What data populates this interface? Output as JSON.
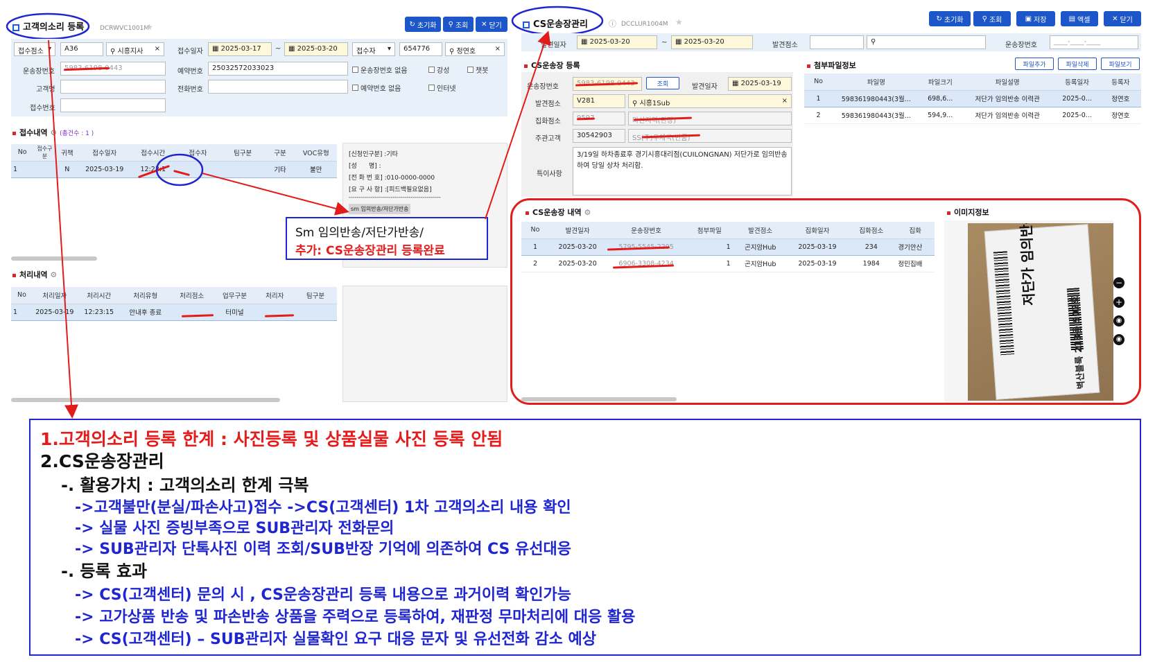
{
  "left": {
    "title": "고객의소리 등록",
    "code": "DCRWVC1001M",
    "buttons": {
      "reset": "초기화",
      "search": "조회",
      "close": "닫기"
    },
    "filters": {
      "recv_point_label": "접수점소",
      "recv_point_code": "A36",
      "recv_point_name": "시흥지사",
      "recv_date_label": "접수일자",
      "date_from": "2025-03-17",
      "date_sep": "~",
      "date_to": "2025-03-20",
      "receiver_label": "접수자",
      "receiver_id": "654776",
      "receiver_name": "정연호",
      "waybill_label": "운송장번호",
      "waybill_value": "5983-6198-0443",
      "reserve_label": "예약번호",
      "reserve_value": "25032572033023",
      "chk_no_waybill": "운송장번호 없음",
      "chk_strong": "강성",
      "chk_chatbot": "챗봇",
      "customer_label": "고객명",
      "phone_label": "전화번호",
      "chk_no_reserve": "예약번호 없음",
      "chk_internet": "인터넷",
      "recv_no_label": "접수번호"
    },
    "receipt": {
      "title": "접수내역",
      "count": "(총건수 : 1 )",
      "headers": [
        "No",
        "접수구분",
        "귀책",
        "접수일자",
        "접수시간",
        "접수자",
        "팀구분",
        "구분",
        "VOC유형"
      ],
      "rows": [
        [
          "1",
          "",
          "N",
          "2025-03-19",
          "12:23:1",
          "",
          "",
          "기타",
          "불만"
        ]
      ]
    },
    "detail": {
      "l1": "[신청인구분] :기타",
      "l2": "[성      명] :",
      "l3": "[전 화 번 호] :010-0000-0000",
      "l4": "[요 구 사 항] :[피드백필요없음]",
      "dash": "----------------------------------------------",
      "tag": "sm 임의반송/저단가반송"
    },
    "process": {
      "title": "처리내역",
      "headers": [
        "No",
        "처리일자",
        "처리시간",
        "처리유형",
        "처리점소",
        "업무구분",
        "처리자",
        "팀구분"
      ],
      "rows": [
        [
          "1",
          "2025-03-19",
          "12:23:15",
          "안내후 종료",
          "",
          "터미널",
          "",
          ""
        ]
      ]
    }
  },
  "callout": {
    "line1": "Sm 임의반송/저단가반송/",
    "line2": "추가: CS운송장관리 등록완료"
  },
  "right": {
    "title": "CS운송장관리",
    "code": "DCCLUR1004M",
    "buttons": {
      "reset": "초기화",
      "search": "조회",
      "save": "저장",
      "excel": "엑셀",
      "close": "닫기"
    },
    "filters": {
      "issue_date_label": "발견일자",
      "date_from": "2025-03-20",
      "date_sep": "~",
      "date_to": "2025-03-20",
      "issue_point_label": "발견점소",
      "waybill_label": "운송장번호",
      "waybill_placeholder": "____-____-____"
    },
    "register": {
      "title": "CS운송장 등록",
      "waybill_label": "운송장번호",
      "waybill_value": "5983-6198-0443",
      "search_btn": "조회",
      "issue_date_label": "발견일자",
      "issue_date": "2025-03-19",
      "issue_point_label": "발견점소",
      "issue_point_code": "V281",
      "issue_point_name": "시흥1Sub",
      "collect_point_label": "집화점소",
      "collect_point_code": "9597",
      "collect_point_name": "마산지역(관장)",
      "main_customer_label": "주관고객",
      "main_customer_code": "30542903",
      "main_customer_name": "SS(주)우체국(반품)",
      "note_label": "특이사항",
      "note_text": "3/19일 하차종료후 경기시흥대리점(CUILONGNAN) 저단가로 임의반송하여 당일 상차 처리함."
    },
    "attach": {
      "title": "첨부파일정보",
      "btn_add": "파일추가",
      "btn_delete": "파일삭제",
      "btn_view": "파일보기",
      "headers": [
        "No",
        "파일명",
        "파일크기",
        "파일설명",
        "등록일자",
        "등록자"
      ],
      "rows": [
        [
          "1",
          "598361980443(3월...",
          "698,6...",
          "저단가 임의반송 이력관",
          "2025-0...",
          "정연호"
        ],
        [
          "2",
          "598361980443(3월...",
          "594,9...",
          "저단가 임의반송 이력관",
          "2025-0...",
          "정연호"
        ]
      ]
    },
    "history": {
      "title": "CS운송장 내역",
      "headers": [
        "No",
        "발견일자",
        "운송장번호",
        "첨부파일",
        "발견점소",
        "집화일자",
        "집화점소",
        "집화"
      ],
      "rows": [
        [
          "1",
          "2025-03-20",
          "5795-5545-2295",
          "1",
          "곤지암Hub",
          "2025-03-19",
          "234",
          "경기안산"
        ],
        [
          "2",
          "2025-03-20",
          "6906-3308-4234",
          "1",
          "곤지암Hub",
          "2025-03-19",
          "1984",
          "정민집배"
        ]
      ]
    },
    "image": {
      "title": "이미지정보",
      "handwritten": "저단가 임의반송",
      "address": "벽산블룩 213동 502호"
    }
  },
  "annotation": {
    "l1": "1.고객의소리 등록 한계 : 사진등록 및 상품실물 사진 등록 안됨",
    "l2": "2.CS운송장관리",
    "l3": "-. 활용가치 : 고객의소리 한계 극복",
    "l4": "->고객불만(분실/파손사고)접수 ->CS(고객센터) 1차 고객의소리 내용 확인",
    "l5": "-> 실물 사진 증빙부족으로 SUB관리자 전화문의",
    "l6": "-> SUB관리자 단톡사진 이력 조회/SUB반장 기억에 의존하여 CS 유선대응",
    "l7": "-. 등록 효과",
    "l8": "-> CS(고객센터) 문의 시 , CS운송장관리 등록 내용으로 과거이력 확인가능",
    "l9": "-> 고가상품 반송 및 파손반송 상품을 주력으로 등록하여, 재판정 무마처리에 대응 활용",
    "l10": "-> CS(고객센터) – SUB관리자 실물확인 요구 대응 문자 및 유선전화 감소 예상"
  }
}
